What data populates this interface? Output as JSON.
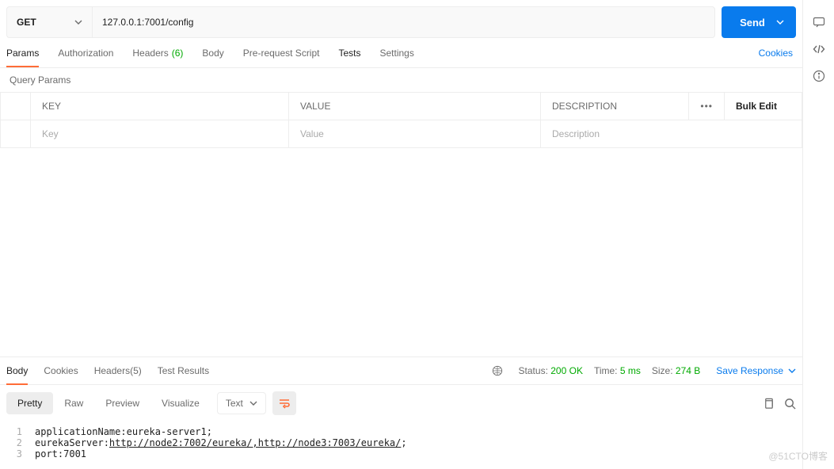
{
  "request": {
    "method": "GET",
    "url": "127.0.0.1:7001/config",
    "send_label": "Send"
  },
  "tabs": {
    "params": "Params",
    "authorization": "Authorization",
    "headers": "Headers",
    "headers_count": "(6)",
    "body": "Body",
    "prerequest": "Pre-request Script",
    "tests": "Tests",
    "settings": "Settings"
  },
  "cookies_link": "Cookies",
  "query_params_label": "Query Params",
  "param_headers": {
    "key": "KEY",
    "value": "VALUE",
    "description": "DESCRIPTION",
    "bulk_edit": "Bulk Edit"
  },
  "param_placeholders": {
    "key": "Key",
    "value": "Value",
    "description": "Description"
  },
  "response": {
    "tabs": {
      "body": "Body",
      "cookies": "Cookies",
      "headers": "Headers",
      "headers_count": "(5)",
      "tests": "Test Results"
    },
    "status_label": "Status:",
    "status_value": "200 OK",
    "time_label": "Time:",
    "time_value": "5 ms",
    "size_label": "Size:",
    "size_value": "274 B",
    "save_response": "Save Response",
    "view_modes": {
      "pretty": "Pretty",
      "raw": "Raw",
      "preview": "Preview",
      "visualize": "Visualize"
    },
    "body_type": "Text",
    "lines": [
      {
        "n": "1",
        "plain": "applicationName:eureka-server1;"
      },
      {
        "n": "2",
        "plain_prefix": "eurekaServer:",
        "url": "http://node2:7002/eureka/,http://node3:7003/eureka/",
        "plain_suffix": ";"
      },
      {
        "n": "3",
        "plain": "port:7001"
      }
    ]
  },
  "watermark": "@51CTO博客"
}
